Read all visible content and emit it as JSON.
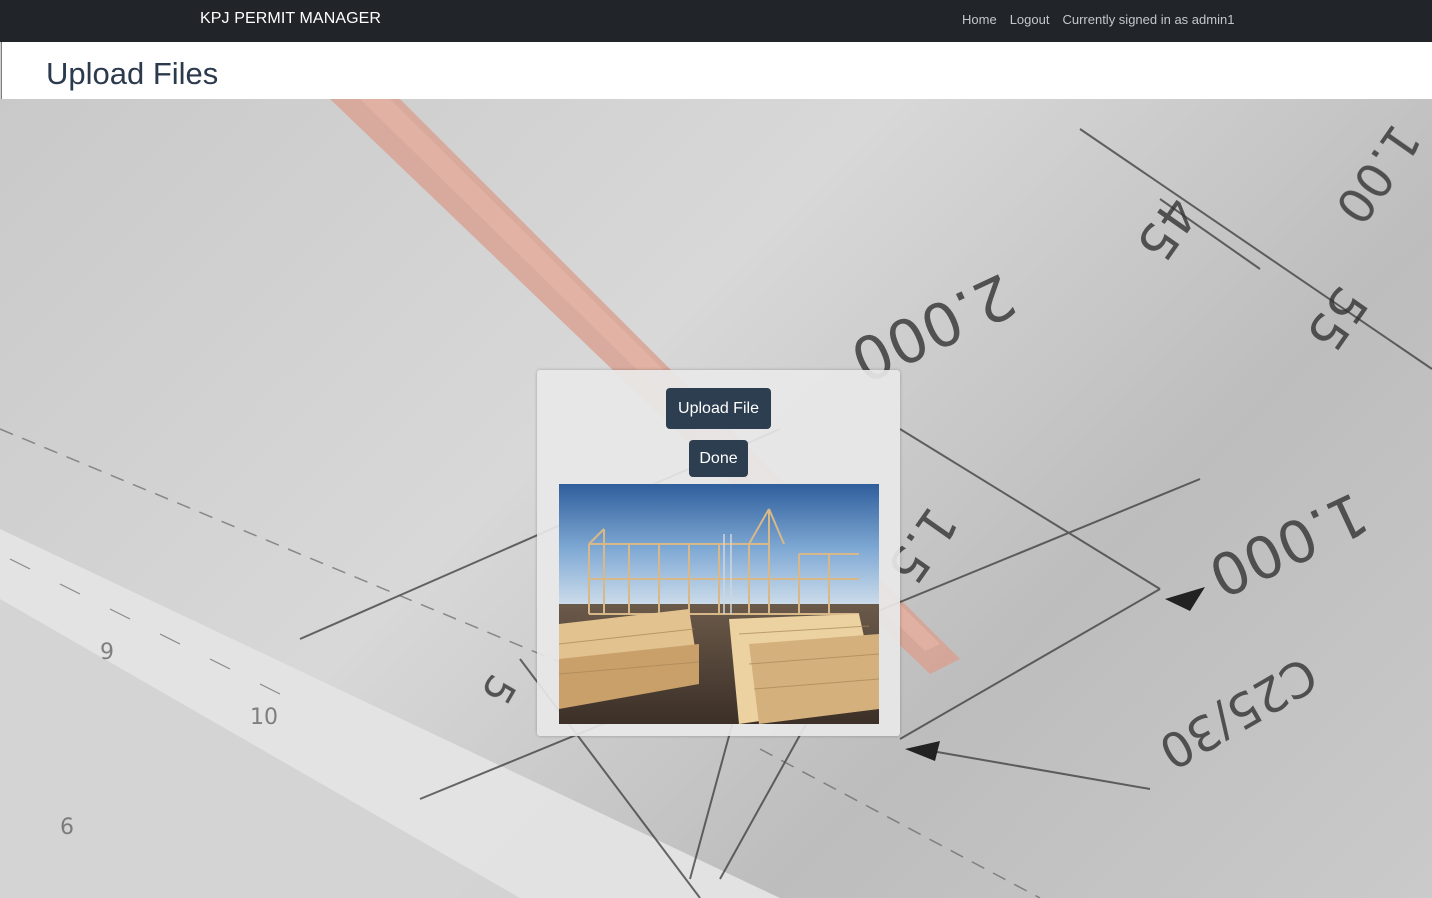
{
  "navbar": {
    "brand": "KPJ PERMIT MANAGER",
    "links": {
      "home": "Home",
      "logout": "Logout"
    },
    "status": "Currently signed in as admin1"
  },
  "header": {
    "title": "Upload Files"
  },
  "panel": {
    "upload_button": "Upload File",
    "done_button": "Done"
  },
  "background_labels": [
    "2.000",
    "45",
    "55",
    "1.000",
    "1.5",
    "C25/30",
    "5",
    "9",
    "10",
    "6",
    "1.00"
  ],
  "colors": {
    "navbar": "#212529",
    "button": "#2c3e50",
    "title": "#2b3a4c"
  }
}
